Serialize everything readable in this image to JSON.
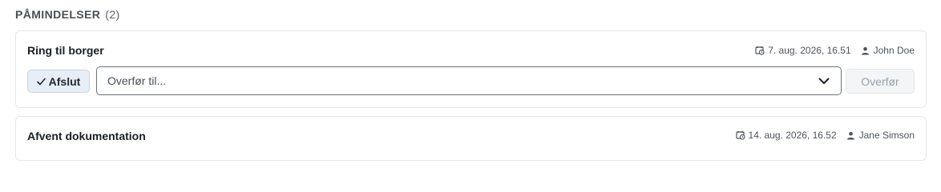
{
  "section": {
    "title": "PÅMINDELSER",
    "count": "(2)"
  },
  "reminders": [
    {
      "title": "Ring til borger",
      "date": "7. aug. 2026, 16.51",
      "assignee": "John Doe",
      "date_icon": "calendar-clock-icon",
      "assignee_icon": "person-icon",
      "actions": {
        "complete_label": "Afslut",
        "complete_icon": "checkmark-icon",
        "transfer_placeholder": "Overfør til...",
        "transfer_icon": "chevron-down-icon",
        "transfer_button_label": "Overfør"
      }
    },
    {
      "title": "Afvent dokumentation",
      "date": "14. aug. 2026, 16.52",
      "assignee": "Jane Simson",
      "date_icon": "calendar-clock-icon",
      "assignee_icon": "person-icon"
    }
  ],
  "colors": {
    "complete_button_bg": "#e8eef5",
    "transfer_button_disabled_text": "#9aa0a7"
  }
}
